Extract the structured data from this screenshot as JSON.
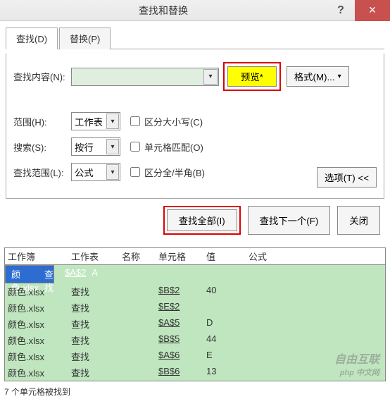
{
  "title": "查找和替换",
  "tabs": {
    "find": "查找(D)",
    "replace": "替换(P)"
  },
  "findContentLabel": "查找内容(N):",
  "previewBtn": "预览*",
  "formatBtn": "格式(M)...",
  "scopeLabel": "范围(H):",
  "scopeValue": "工作表",
  "searchLabel": "搜索(S):",
  "searchValue": "按行",
  "lookInLabel": "查找范围(L):",
  "lookInValue": "公式",
  "chkCase": "区分大小写(C)",
  "chkMatch": "单元格匹配(O)",
  "chkWidth": "区分全/半角(B)",
  "optionsBtn": "选项(T) <<",
  "findAllBtn": "查找全部(I)",
  "findNextBtn": "查找下一个(F)",
  "closeBtn": "关闭",
  "headers": {
    "c0": "工作簿",
    "c1": "工作表",
    "c2": "名称",
    "c3": "单元格",
    "c4": "值",
    "c5": "公式"
  },
  "rows": [
    {
      "wb": "颜色.xlsx",
      "ws": "查找",
      "nm": "",
      "cell": "$A$2",
      "val": "A",
      "fm": "",
      "sel": true
    },
    {
      "wb": "颜色.xlsx",
      "ws": "查找",
      "nm": "",
      "cell": "$B$2",
      "val": "40",
      "fm": "",
      "sel": false
    },
    {
      "wb": "颜色.xlsx",
      "ws": "查找",
      "nm": "",
      "cell": "$E$2",
      "val": "",
      "fm": "",
      "sel": false
    },
    {
      "wb": "颜色.xlsx",
      "ws": "查找",
      "nm": "",
      "cell": "$A$5",
      "val": "D",
      "fm": "",
      "sel": false
    },
    {
      "wb": "颜色.xlsx",
      "ws": "查找",
      "nm": "",
      "cell": "$B$5",
      "val": "44",
      "fm": "",
      "sel": false
    },
    {
      "wb": "颜色.xlsx",
      "ws": "查找",
      "nm": "",
      "cell": "$A$6",
      "val": "E",
      "fm": "",
      "sel": false
    },
    {
      "wb": "颜色.xlsx",
      "ws": "查找",
      "nm": "",
      "cell": "$B$6",
      "val": "13",
      "fm": "",
      "sel": false
    }
  ],
  "status": "7 个单元格被找到",
  "watermark": "自由互联",
  "watermarkSub": "php 中文网"
}
